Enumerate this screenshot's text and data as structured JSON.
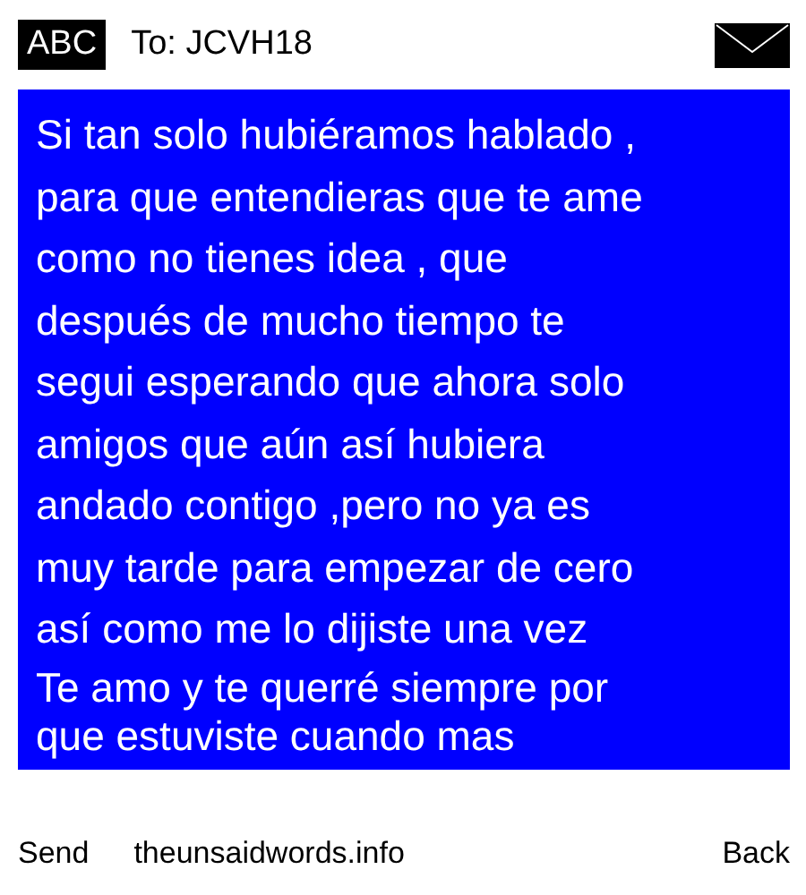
{
  "header": {
    "mode": "ABC",
    "recipient": "To: JCVH18"
  },
  "message": {
    "text": "Si tan solo hubiéramos hablado ,\npara que entendieras que te ame\ncomo no tienes idea , que\ndespués de mucho tiempo te\nsegui esperando que ahora solo\namigos que aún así hubiera\nandado contigo ,pero no ya es\nmuy tarde para empezar de cero\nasí como me lo dijiste una vez",
    "overlay": "Te amo y te querré siempre por",
    "continuation": "que estuviste cuando mas"
  },
  "softkeys": {
    "left": "Send",
    "center": "theunsaidwords.info",
    "right": "Back"
  }
}
